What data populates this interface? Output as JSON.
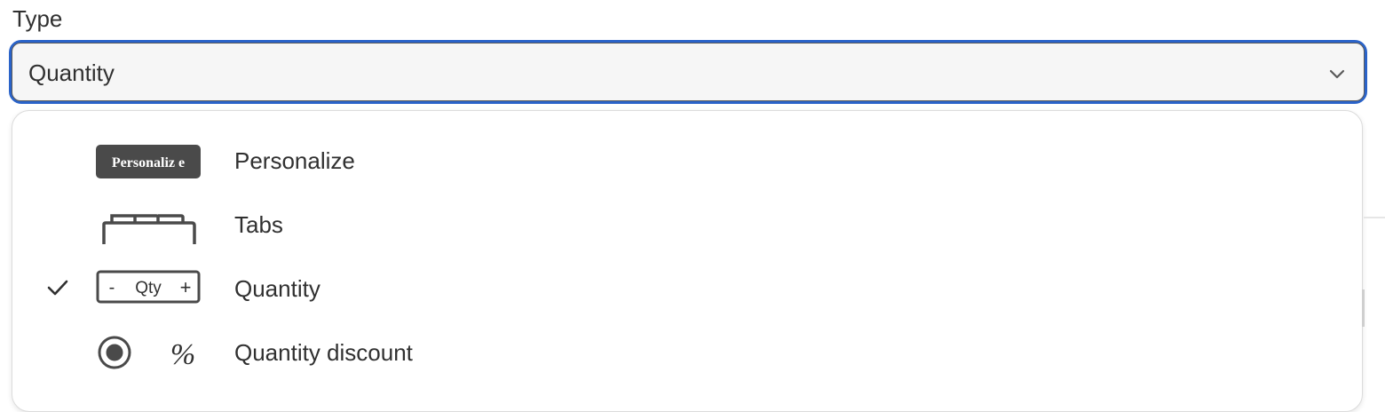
{
  "field": {
    "label": "Type",
    "selected_value": "Quantity"
  },
  "options": [
    {
      "label": "Personalize",
      "icon": "personalize-badge-icon",
      "icon_text": "Personaliz e",
      "selected": false
    },
    {
      "label": "Tabs",
      "icon": "tabs-icon",
      "selected": false
    },
    {
      "label": "Quantity",
      "icon": "quantity-stepper-icon",
      "icon_text_minus": "-",
      "icon_text_qty": "Qty",
      "icon_text_plus": "+",
      "selected": true
    },
    {
      "label": "Quantity discount",
      "icon": "percent-discount-icon",
      "icon_text": "%",
      "selected": false
    }
  ],
  "colors": {
    "focus_ring": "#2a63c9",
    "text": "#303030",
    "icon_dark": "#4a4a4a"
  }
}
